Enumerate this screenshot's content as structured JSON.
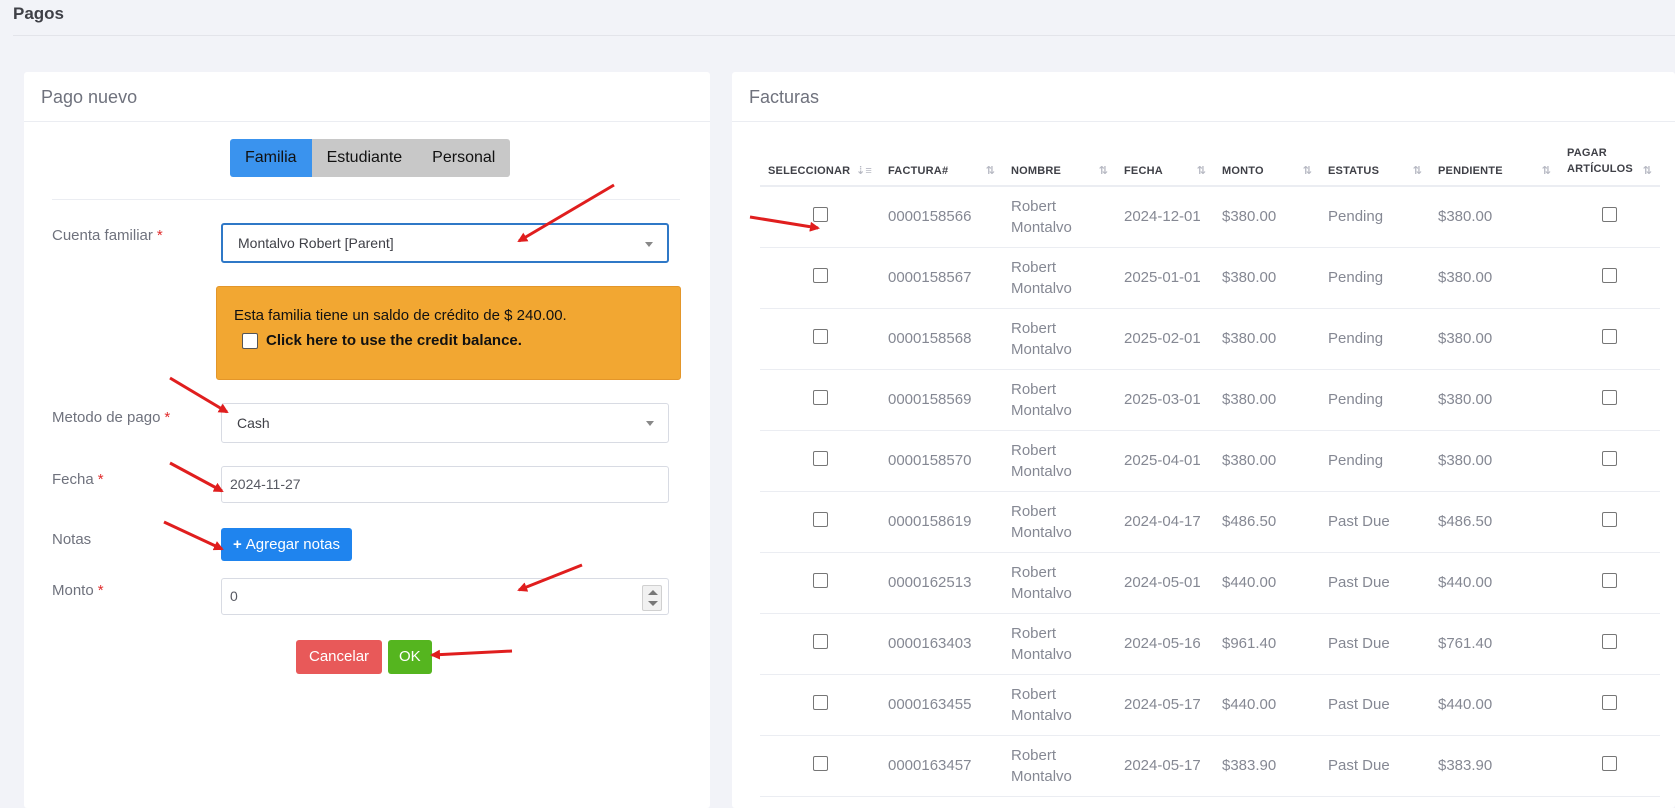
{
  "page": {
    "title": "Pagos"
  },
  "new_payment": {
    "header": "Pago nuevo",
    "tabs": [
      "Familia",
      "Estudiante",
      "Personal"
    ],
    "active_tab": "Familia",
    "family_account": {
      "label": "Cuenta familiar",
      "required": "*",
      "value": "Montalvo Robert [Parent]"
    },
    "credit_alert": {
      "message": "Esta familia tiene un saldo de crédito de $ 240.00.",
      "checkbox_label": "Click here to use the credit balance."
    },
    "payment_method": {
      "label": "Metodo de pago",
      "required": "*",
      "value": "Cash"
    },
    "date": {
      "label": "Fecha",
      "required": "*",
      "value": "2024-11-27"
    },
    "notes": {
      "label": "Notas",
      "button_icon": "+",
      "button_label": "Agregar notas"
    },
    "amount": {
      "label": "Monto",
      "required": "*",
      "value": "0"
    },
    "cancel_label": "Cancelar",
    "ok_label": "OK",
    "colors": {
      "primary": "#2f8fef",
      "warning": "#f2a732",
      "danger": "#e85959",
      "success": "#55b51f"
    }
  },
  "invoices": {
    "header": "Facturas",
    "columns": [
      "SELECCIONAR",
      "FACTURA#",
      "NOMBRE",
      "FECHA",
      "MONTO",
      "ESTATUS",
      "PENDIENTE",
      "PAGAR ARTÍCULOS"
    ],
    "rows": [
      {
        "invoice": "0000158566",
        "name": "Robert Montalvo",
        "date": "2024-12-01",
        "amount": "$380.00",
        "status": "Pending",
        "pending": "$380.00"
      },
      {
        "invoice": "0000158567",
        "name": "Robert Montalvo",
        "date": "2025-01-01",
        "amount": "$380.00",
        "status": "Pending",
        "pending": "$380.00"
      },
      {
        "invoice": "0000158568",
        "name": "Robert Montalvo",
        "date": "2025-02-01",
        "amount": "$380.00",
        "status": "Pending",
        "pending": "$380.00"
      },
      {
        "invoice": "0000158569",
        "name": "Robert Montalvo",
        "date": "2025-03-01",
        "amount": "$380.00",
        "status": "Pending",
        "pending": "$380.00"
      },
      {
        "invoice": "0000158570",
        "name": "Robert Montalvo",
        "date": "2025-04-01",
        "amount": "$380.00",
        "status": "Pending",
        "pending": "$380.00"
      },
      {
        "invoice": "0000158619",
        "name": "Robert Montalvo",
        "date": "2024-04-17",
        "amount": "$486.50",
        "status": "Past Due",
        "pending": "$486.50"
      },
      {
        "invoice": "0000162513",
        "name": "Robert Montalvo",
        "date": "2024-05-01",
        "amount": "$440.00",
        "status": "Past Due",
        "pending": "$440.00"
      },
      {
        "invoice": "0000163403",
        "name": "Robert Montalvo",
        "date": "2024-05-16",
        "amount": "$961.40",
        "status": "Past Due",
        "pending": "$761.40"
      },
      {
        "invoice": "0000163455",
        "name": "Robert Montalvo",
        "date": "2024-05-17",
        "amount": "$440.00",
        "status": "Past Due",
        "pending": "$440.00"
      },
      {
        "invoice": "0000163457",
        "name": "Robert Montalvo",
        "date": "2024-05-17",
        "amount": "$383.90",
        "status": "Past Due",
        "pending": "$383.90"
      }
    ]
  }
}
